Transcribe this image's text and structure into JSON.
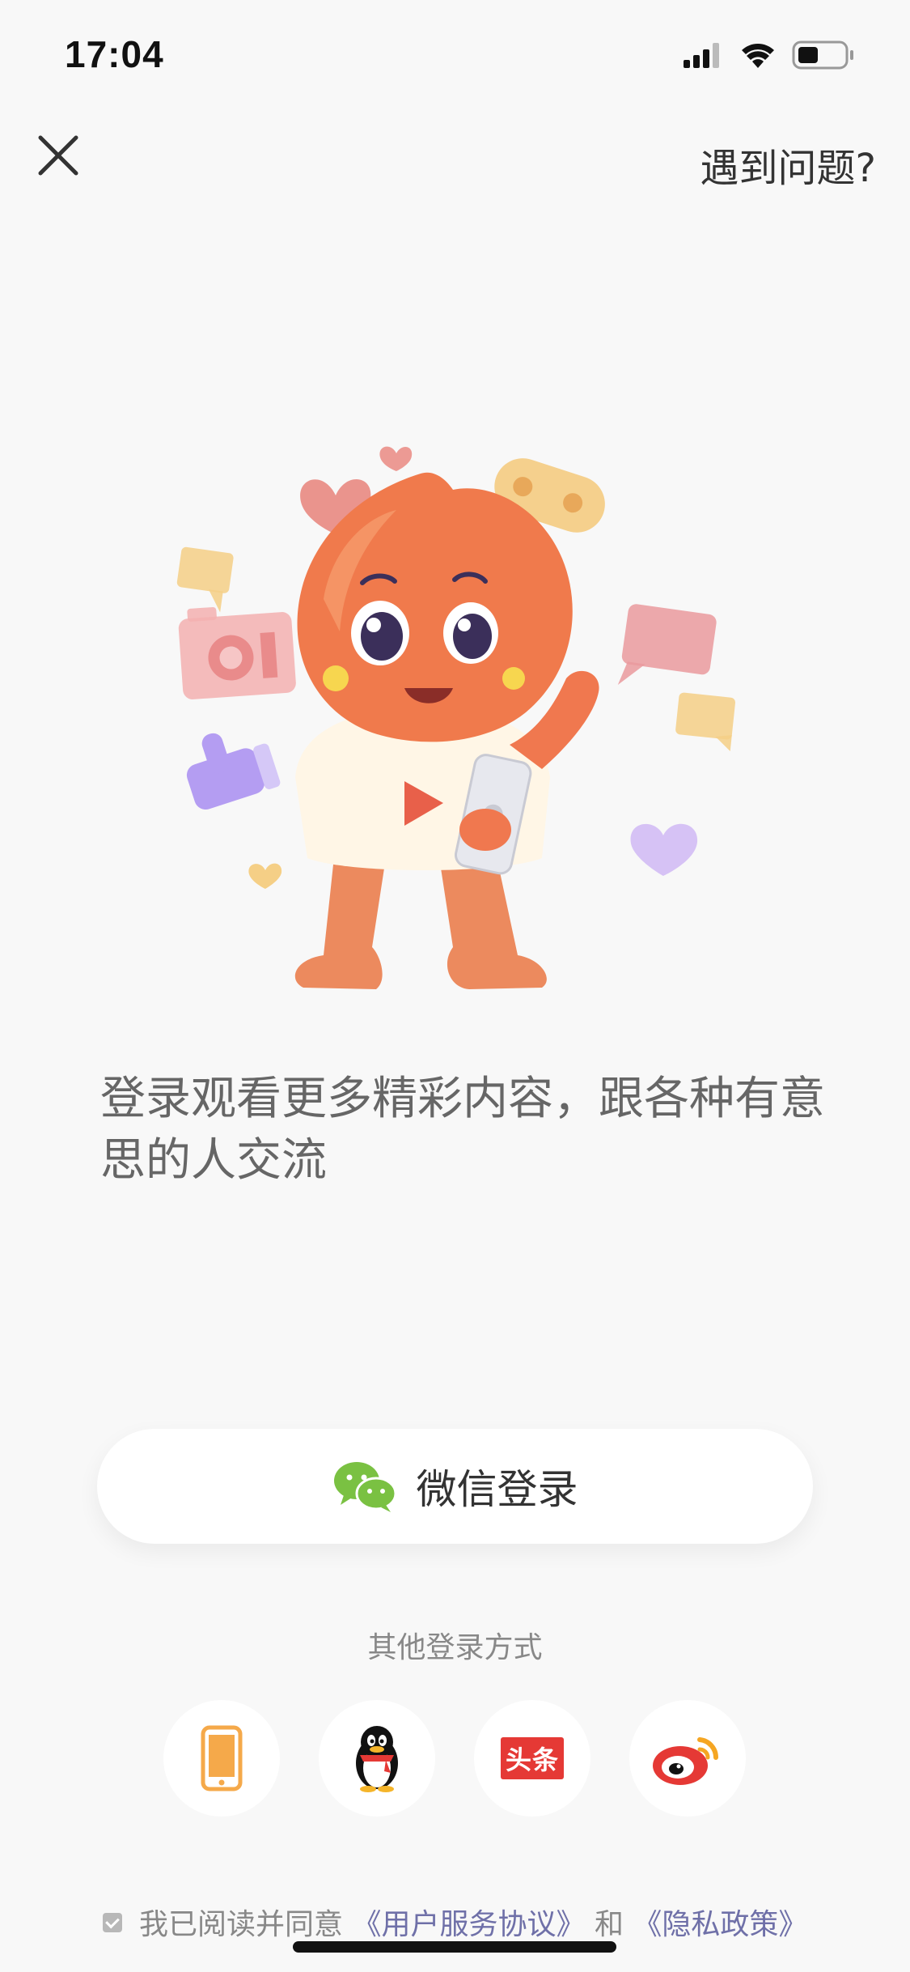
{
  "status_bar": {
    "time": "17:04"
  },
  "nav": {
    "close_icon": "close-icon",
    "help_label": "遇到问题?"
  },
  "headline": "登录观看更多精彩内容，跟各种有意思的人交流",
  "wechat_login": {
    "label": "微信登录",
    "icon": "wechat-icon",
    "brand_color": "#7ac142"
  },
  "other_login": {
    "title": "其他登录方式",
    "options": [
      {
        "name": "phone",
        "icon": "phone-icon",
        "color": "#f5a94a"
      },
      {
        "name": "qq",
        "icon": "qq-penguin-icon",
        "color": "#111111"
      },
      {
        "name": "toutiao",
        "icon": "toutiao-icon",
        "text": "头条",
        "color": "#e53935"
      },
      {
        "name": "weibo",
        "icon": "weibo-icon",
        "color": "#e53935"
      }
    ]
  },
  "agreement": {
    "checked": true,
    "prefix": "我已阅读并同意",
    "terms_link": "《用户服务协议》",
    "conjunction": "和",
    "privacy_link": "《隐私政策》",
    "link_color": "#6f70a8"
  },
  "colors": {
    "background": "#f8f8f8",
    "mascot": "#f0784f",
    "text_primary": "#333333",
    "text_secondary": "#888888"
  }
}
